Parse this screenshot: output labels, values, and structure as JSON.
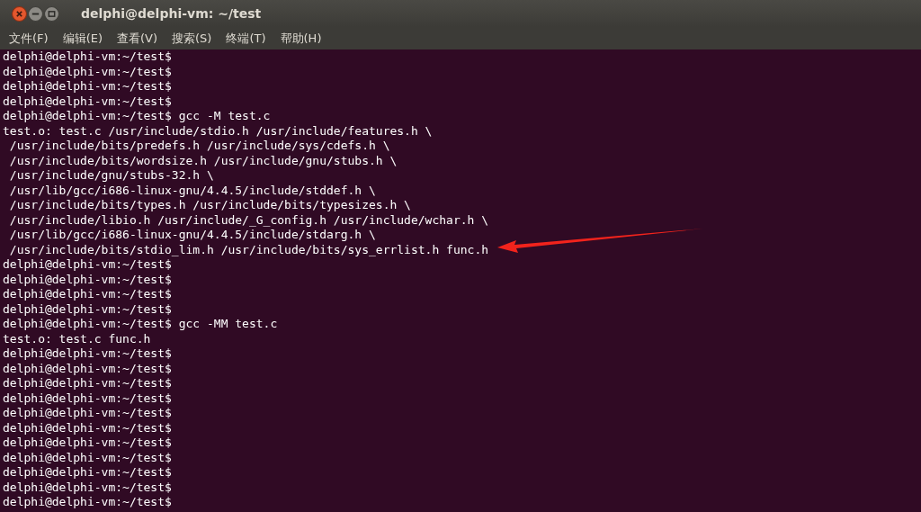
{
  "window": {
    "title": "delphi@delphi-vm: ~/test"
  },
  "menu": [
    "文件(F)",
    "编辑(E)",
    "查看(V)",
    "搜索(S)",
    "终端(T)",
    "帮助(H)"
  ],
  "terminal": {
    "lines": [
      "delphi@delphi-vm:~/test$",
      "delphi@delphi-vm:~/test$",
      "delphi@delphi-vm:~/test$",
      "delphi@delphi-vm:~/test$",
      "delphi@delphi-vm:~/test$ gcc -M test.c",
      "test.o: test.c /usr/include/stdio.h /usr/include/features.h \\",
      " /usr/include/bits/predefs.h /usr/include/sys/cdefs.h \\",
      " /usr/include/bits/wordsize.h /usr/include/gnu/stubs.h \\",
      " /usr/include/gnu/stubs-32.h \\",
      " /usr/lib/gcc/i686-linux-gnu/4.4.5/include/stddef.h \\",
      " /usr/include/bits/types.h /usr/include/bits/typesizes.h \\",
      " /usr/include/libio.h /usr/include/_G_config.h /usr/include/wchar.h \\",
      " /usr/lib/gcc/i686-linux-gnu/4.4.5/include/stdarg.h \\",
      " /usr/include/bits/stdio_lim.h /usr/include/bits/sys_errlist.h func.h",
      "delphi@delphi-vm:~/test$",
      "delphi@delphi-vm:~/test$",
      "delphi@delphi-vm:~/test$",
      "delphi@delphi-vm:~/test$",
      "delphi@delphi-vm:~/test$ gcc -MM test.c",
      "test.o: test.c func.h",
      "delphi@delphi-vm:~/test$",
      "delphi@delphi-vm:~/test$",
      "delphi@delphi-vm:~/test$",
      "delphi@delphi-vm:~/test$",
      "delphi@delphi-vm:~/test$",
      "delphi@delphi-vm:~/test$",
      "delphi@delphi-vm:~/test$",
      "delphi@delphi-vm:~/test$",
      "delphi@delphi-vm:~/test$",
      "delphi@delphi-vm:~/test$",
      "delphi@delphi-vm:~/test$"
    ]
  }
}
